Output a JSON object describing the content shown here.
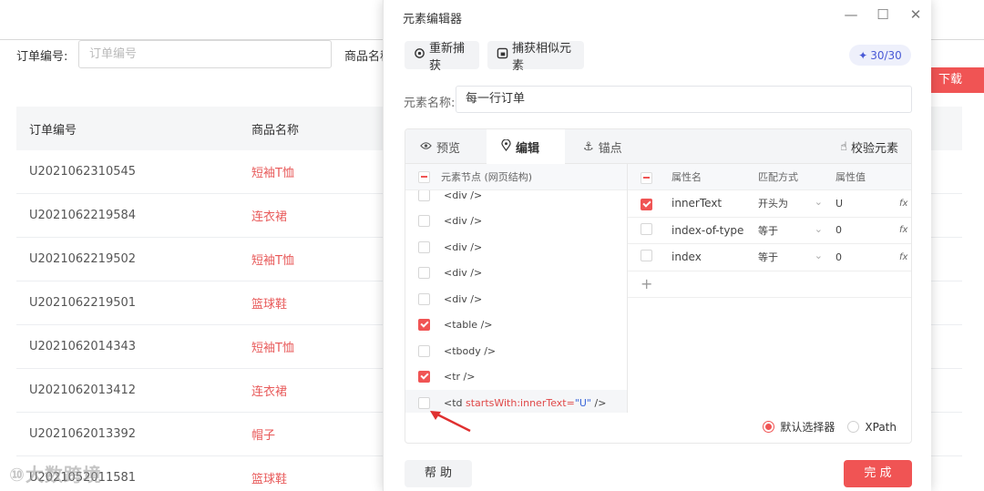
{
  "background": {
    "filter_label": "订单编号:",
    "filter_placeholder": "订单编号",
    "filter_label2": "商品名称",
    "download_label": "下载",
    "columns": [
      "订单编号",
      "商品名称"
    ],
    "rows": [
      {
        "order": "U2021062310545",
        "product": "短袖T恤"
      },
      {
        "order": "U2021062219584",
        "product": "连衣裙"
      },
      {
        "order": "U2021062219502",
        "product": "短袖T恤"
      },
      {
        "order": "U2021062219501",
        "product": "篮球鞋"
      },
      {
        "order": "U2021062014343",
        "product": "短袖T恤"
      },
      {
        "order": "U2021062013412",
        "product": "连衣裙"
      },
      {
        "order": "U2021062013392",
        "product": "帽子"
      },
      {
        "order": "U2021052011581",
        "product": "篮球鞋"
      }
    ],
    "watermark": "⑩大数跨境"
  },
  "dialog": {
    "title": "元素编辑器",
    "recapture_label": "重新捕获",
    "capture_similar_label": "捕获相似元素",
    "quota": "30/30",
    "name_label": "元素名称:",
    "name_value": "每一行订单",
    "tabs": {
      "preview": "预览",
      "edit": "编辑",
      "anchor": "锚点"
    },
    "verify_label": "校验元素",
    "nodes_header": "元素节点 (网页结构)",
    "nodes": [
      {
        "tag": "<div />",
        "checked": false
      },
      {
        "tag": "<div />",
        "checked": false
      },
      {
        "tag": "<div />",
        "checked": false
      },
      {
        "tag": "<div />",
        "checked": false
      },
      {
        "tag": "<div />",
        "checked": false
      },
      {
        "tag": "<table />",
        "checked": true
      },
      {
        "tag": "<tbody />",
        "checked": false
      },
      {
        "tag": "<tr />",
        "checked": true
      }
    ],
    "last_node": {
      "prefix": "<td",
      "attr": "startsWith:innerText=",
      "value": "\"U\"",
      "suffix": "/>"
    },
    "attr_headers": {
      "name": "属性名",
      "match": "匹配方式",
      "value": "属性值"
    },
    "attrs": [
      {
        "name": "innerText",
        "match": "开头为",
        "value": "U",
        "checked": true
      },
      {
        "name": "index-of-type",
        "match": "等于",
        "value": "0",
        "checked": false
      },
      {
        "name": "index",
        "match": "等于",
        "value": "0",
        "checked": false
      }
    ],
    "fx_label": "fx",
    "add_label": "+",
    "selector_default": "默认选择器",
    "selector_xpath": "XPath",
    "help_label": "帮 助",
    "finish_label": "完 成"
  },
  "colors": {
    "accent": "#f05454",
    "link": "#3a66d9"
  }
}
